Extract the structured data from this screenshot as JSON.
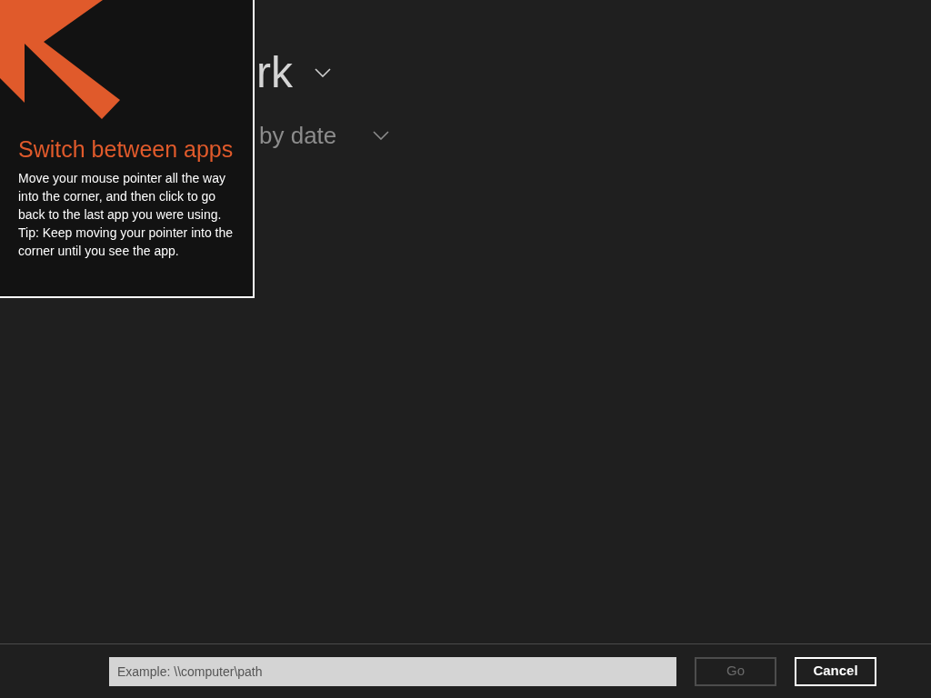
{
  "tip": {
    "title": "Switch between apps",
    "body": [
      "Move your mouse pointer all the way into the corner, and then click to go back to the last app you were using.",
      "Tip: Keep moving your pointer into the corner until you see the app."
    ]
  },
  "header": {
    "title": "rk",
    "sort": "by date"
  },
  "address_bar": {
    "placeholder": "Example: \\\\computer\\path",
    "buttons": [
      {
        "label": "Go",
        "disabled": true
      },
      {
        "label": "Cancel",
        "disabled": false
      }
    ]
  }
}
